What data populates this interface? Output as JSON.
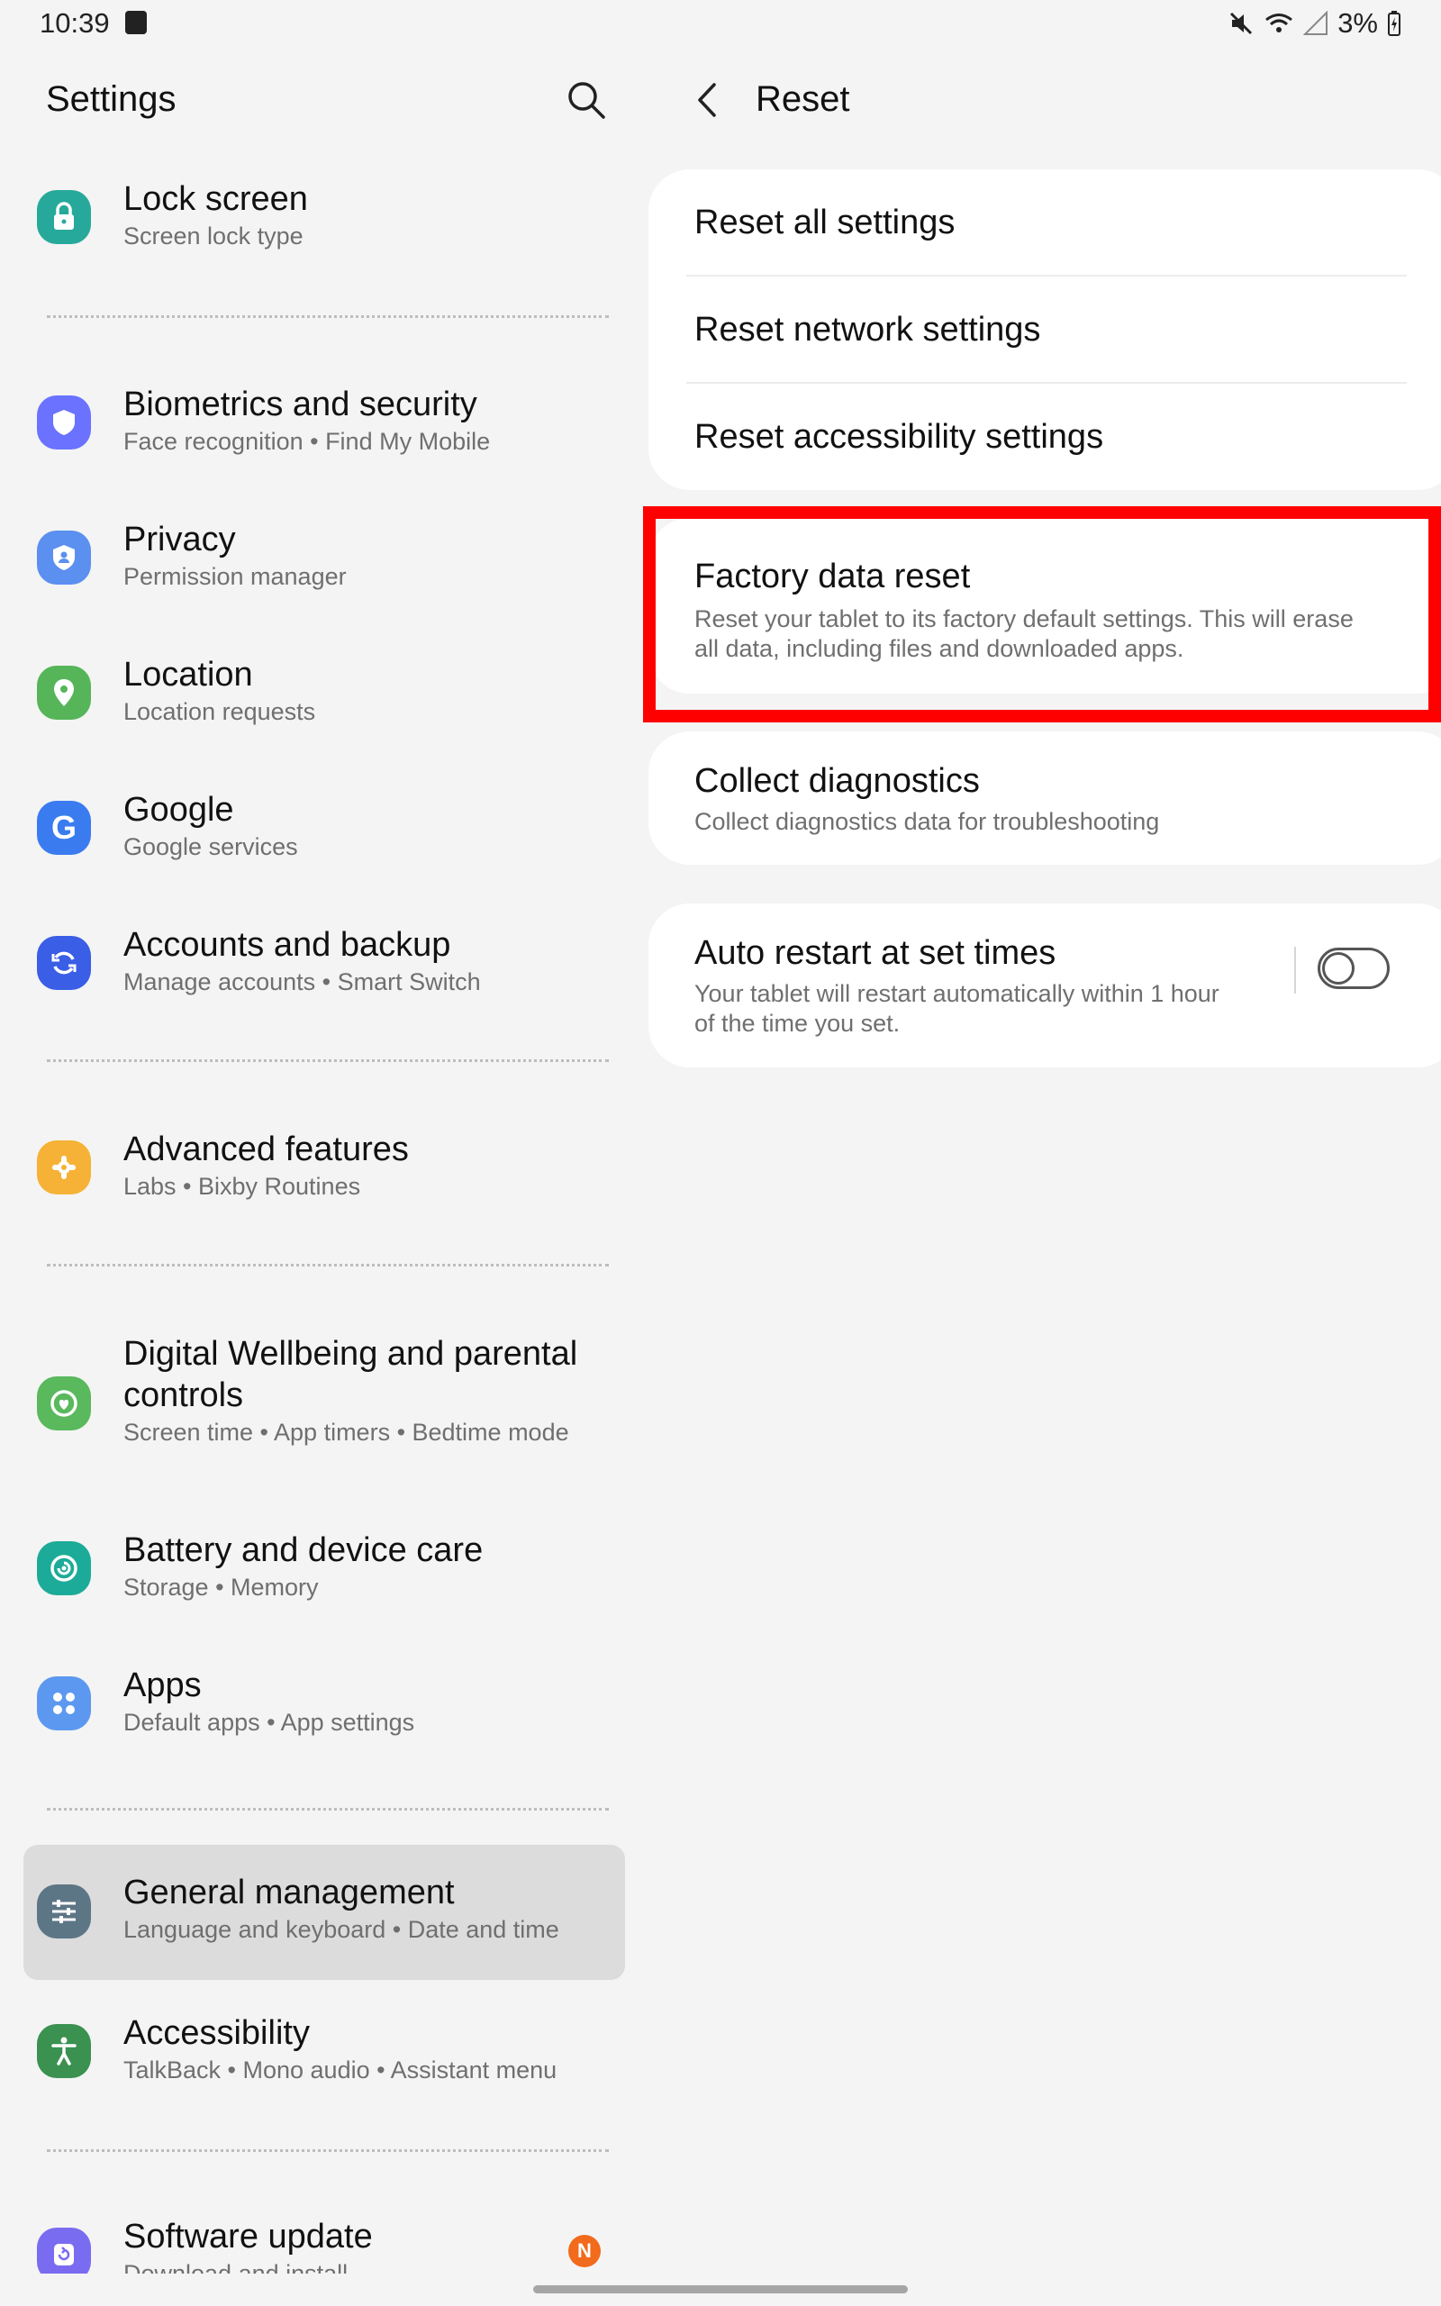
{
  "status_bar": {
    "time": "10:39",
    "battery_percent": "3%"
  },
  "left_pane": {
    "header": "Settings",
    "items": [
      {
        "title": "Lock screen",
        "subtitle": "Screen lock type",
        "icon": "lock-icon",
        "color": "#26a99a"
      },
      {
        "title": "Biometrics and security",
        "subtitle": "Face recognition  •  Find My Mobile",
        "icon": "shield-icon",
        "color": "#6a72ff"
      },
      {
        "title": "Privacy",
        "subtitle": "Permission manager",
        "icon": "privacy-icon",
        "color": "#5b8ff0"
      },
      {
        "title": "Location",
        "subtitle": "Location requests",
        "icon": "location-pin-icon",
        "color": "#56b559"
      },
      {
        "title": "Google",
        "subtitle": "Google services",
        "icon": "google-icon",
        "color": "#3a7bf0"
      },
      {
        "title": "Accounts and backup",
        "subtitle": "Manage accounts  •  Smart Switch",
        "icon": "sync-icon",
        "color": "#3a5ee6"
      },
      {
        "title": "Advanced features",
        "subtitle": "Labs  •  Bixby Routines",
        "icon": "puzzle-icon",
        "color": "#f6b236"
      },
      {
        "title": "Digital Wellbeing and parental controls",
        "subtitle": "Screen time  •  App timers  •  Bedtime mode",
        "icon": "wellbeing-icon",
        "color": "#59b95c"
      },
      {
        "title": "Battery and device care",
        "subtitle": "Storage  •  Memory",
        "icon": "device-care-icon",
        "color": "#1cab99"
      },
      {
        "title": "Apps",
        "subtitle": "Default apps  •  App settings",
        "icon": "apps-grid-icon",
        "color": "#5c98f0"
      },
      {
        "title": "General management",
        "subtitle": "Language and keyboard  •  Date and time",
        "icon": "sliders-icon",
        "color": "#5c7686"
      },
      {
        "title": "Accessibility",
        "subtitle": "TalkBack  •  Mono audio  •  Assistant menu",
        "icon": "accessibility-icon",
        "color": "#3a9150"
      },
      {
        "title": "Software update",
        "subtitle": "Download and install",
        "icon": "software-update-icon",
        "color": "#7a6cf0",
        "badge": "N"
      }
    ]
  },
  "right_pane": {
    "title": "Reset",
    "reset_options": [
      "Reset all settings",
      "Reset network settings",
      "Reset accessibility settings"
    ],
    "factory_reset": {
      "title": "Factory data reset",
      "subtitle_line1": "Reset your tablet to its factory default settings. This will erase",
      "subtitle_line2": "all data, including files and downloaded apps."
    },
    "diagnostics": {
      "title": "Collect diagnostics",
      "subtitle": "Collect diagnostics data for troubleshooting"
    },
    "auto_restart": {
      "title": "Auto restart at set times",
      "subtitle_line1": "Your tablet will restart automatically within 1 hour",
      "subtitle_line2": "of the time you set.",
      "enabled": false
    }
  },
  "colors": {
    "highlight": "#ff0000",
    "selected_bg": "#dcdcdc",
    "badge": "#f26a1b"
  }
}
